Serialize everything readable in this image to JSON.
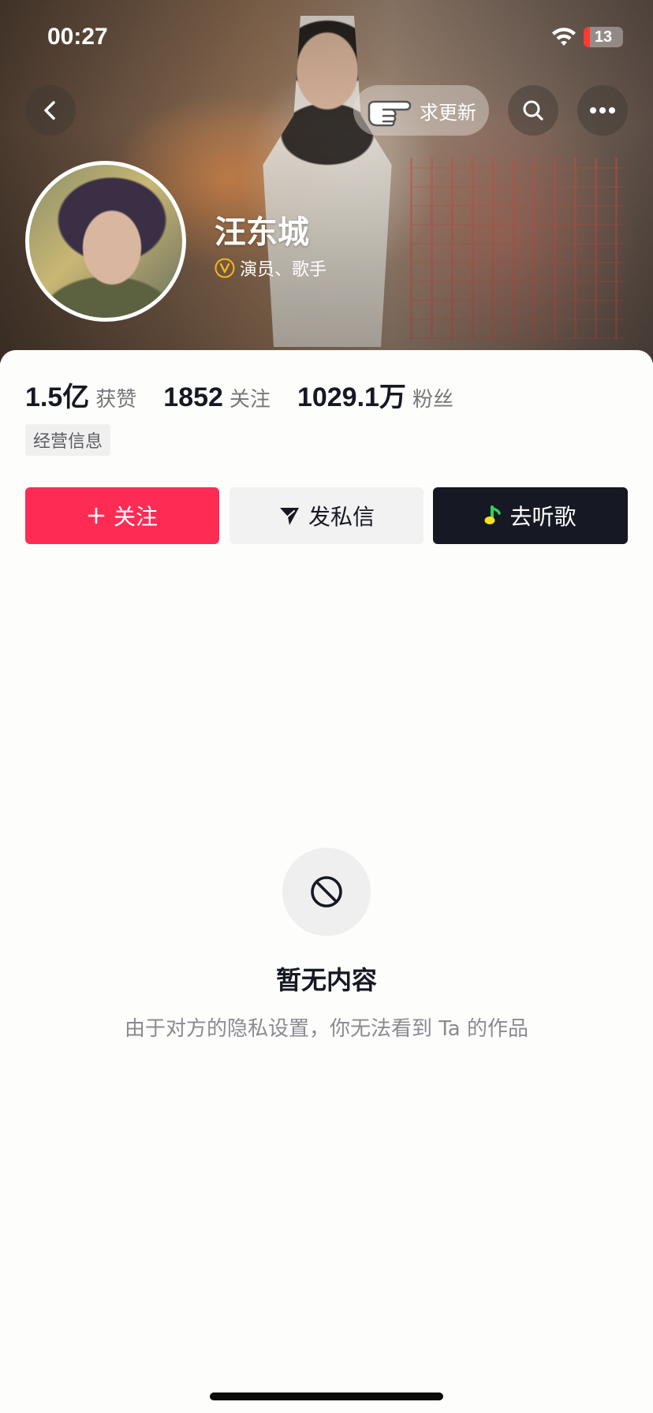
{
  "status_bar": {
    "time": "00:27",
    "battery": "13",
    "battery_color": "#ff3b30"
  },
  "header": {
    "back_icon": "chevron-left-icon",
    "update_label": "求更新",
    "update_icon": "pointing-hand-icon",
    "search_icon": "search-icon",
    "more_icon": "more-dots-icon"
  },
  "profile": {
    "name": "汪东城",
    "verification": "演员、歌手",
    "verify_icon": "verified-badge-icon",
    "verify_color": "#f5b51f"
  },
  "stats": [
    {
      "value": "1.5亿",
      "label": "获赞"
    },
    {
      "value": "1852",
      "label": "关注"
    },
    {
      "value": "1029.1万",
      "label": "粉丝"
    }
  ],
  "tag": "经营信息",
  "actions": {
    "follow": "关注",
    "message": "发私信",
    "music": "去听歌",
    "follow_color": "#fe2c55",
    "music_color": "#161823"
  },
  "empty": {
    "icon": "prohibited-icon",
    "title": "暂无内容",
    "description": "由于对方的隐私设置，你无法看到 Ta 的作品"
  }
}
